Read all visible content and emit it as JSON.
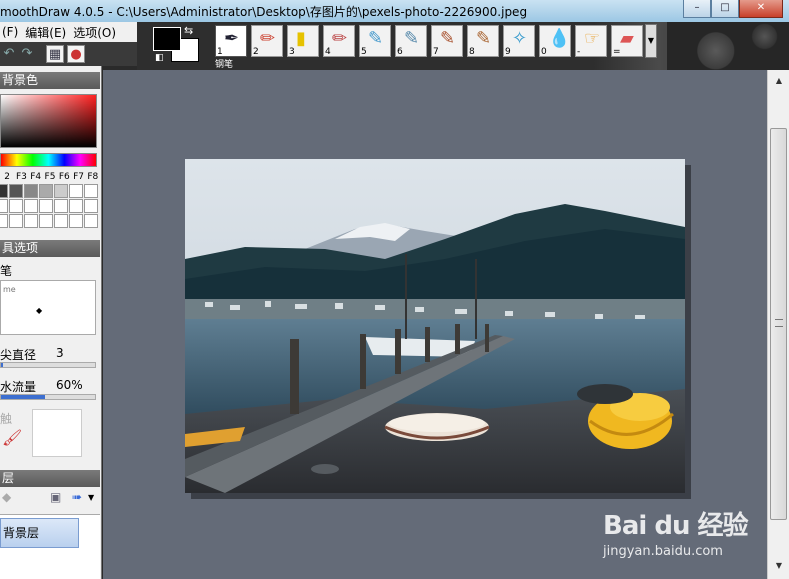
{
  "window": {
    "title": "moothDraw 4.0.5 - C:\\Users\\Administrator\\Desktop\\存图片的\\pexels-photo-2226900.jpeg",
    "controls": [
      "–",
      "□",
      "✕"
    ]
  },
  "menu": {
    "items": [
      "(F)",
      "编辑(E)",
      "选项(O)"
    ]
  },
  "toolbar": {
    "undo_icon": "undo-icon",
    "redo_icon": "redo-icon"
  },
  "colors": {
    "foreground": "#000000",
    "background": "#ffffff",
    "workspace": "#646b78"
  },
  "brushes": {
    "items": [
      {
        "num": "1",
        "icon": "pen-icon",
        "glyph": "✒",
        "color": "#223"
      },
      {
        "num": "2",
        "icon": "pencil-icon",
        "glyph": "✏",
        "color": "#c43"
      },
      {
        "num": "3",
        "icon": "marker-icon",
        "glyph": "▮",
        "color": "#e6c200"
      },
      {
        "num": "4",
        "icon": "crayon-icon",
        "glyph": "✏",
        "color": "#b44"
      },
      {
        "num": "5",
        "icon": "airbrush-icon",
        "glyph": "✎",
        "color": "#49c"
      },
      {
        "num": "6",
        "icon": "spray-icon",
        "glyph": "✎",
        "color": "#58a"
      },
      {
        "num": "7",
        "icon": "brush-icon",
        "glyph": "✎",
        "color": "#a53"
      },
      {
        "num": "8",
        "icon": "oil-brush-icon",
        "glyph": "✎",
        "color": "#a63"
      },
      {
        "num": "9",
        "icon": "blur-icon",
        "glyph": "✧",
        "color": "#39c"
      },
      {
        "num": "0",
        "icon": "water-drop-icon",
        "glyph": "💧",
        "color": "#37c"
      },
      {
        "num": "-",
        "icon": "smudge-finger-icon",
        "glyph": "☞",
        "color": "#e8a030"
      },
      {
        "num": "=",
        "icon": "eraser-icon",
        "glyph": "▰",
        "color": "#d55"
      }
    ],
    "selected_label": "钢笔"
  },
  "left_panel": {
    "color_header": "背景色",
    "fkeys": [
      "2",
      "F3",
      "F4",
      "F5",
      "F6",
      "F7",
      "F8"
    ],
    "swatch_colors": [
      "#333333",
      "#555555",
      "#888888",
      "#aaaaaa",
      "#cccccc",
      "#ffffff",
      "#ffffff",
      "#ffffff",
      "#ffffff",
      "#ffffff",
      "#ffffff",
      "#ffffff",
      "#ffffff",
      "#ffffff",
      "#ffffff",
      "#ffffff",
      "#ffffff",
      "#ffffff",
      "#ffffff",
      "#ffffff",
      "#ffffff"
    ],
    "tool_options_header": "具选项",
    "pressure_label": "笔",
    "pressure_small": "me",
    "tip_diameter_label": "尖直径",
    "tip_diameter_value": "3",
    "ink_flow_label": "水流量",
    "ink_flow_value": "60%",
    "ink_flow_fraction": 0.47,
    "blend_label": "触",
    "layers_header": "层",
    "layer_name": "背景层"
  },
  "watermark": {
    "main": "Bai du 经验",
    "sub": "jingyan.baidu.com"
  }
}
